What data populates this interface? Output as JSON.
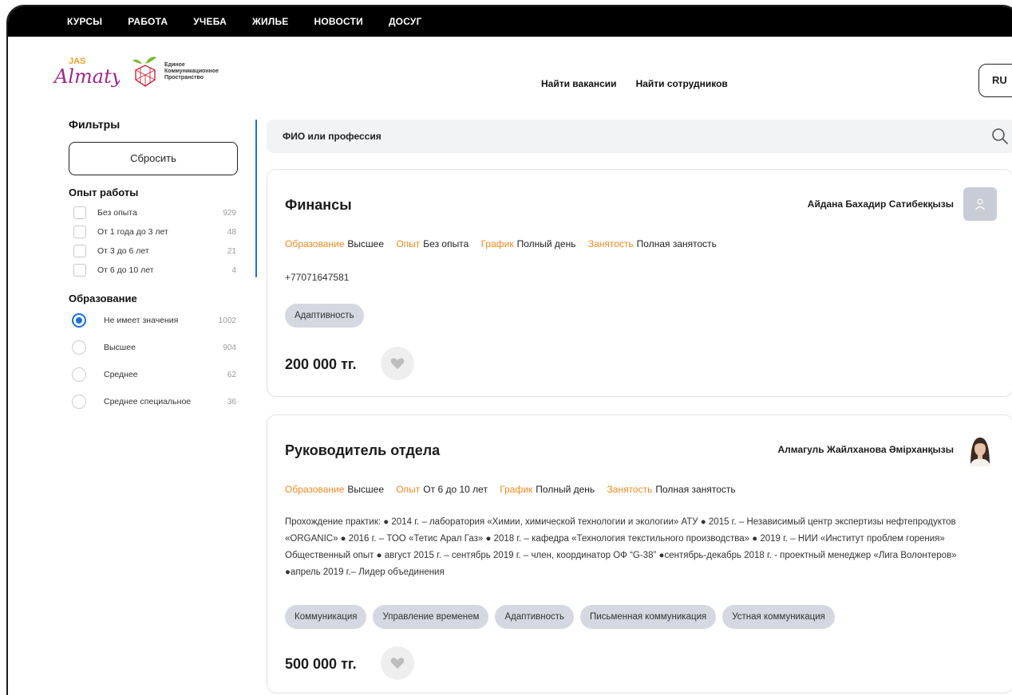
{
  "topnav": [
    "КУРСЫ",
    "РАБОТА",
    "УЧЕБА",
    "ЖИЛЬЕ",
    "НОВОСТИ",
    "ДОСУГ"
  ],
  "header": {
    "logo_jas": "JAS",
    "logo_almaty": "Almaty",
    "logo_ekp": [
      "Единое",
      "Коммуникационное",
      "Пространство"
    ],
    "link_vacancies": "Найти вакансии",
    "link_employees": "Найти сотрудников",
    "lang": "RU"
  },
  "sidebar": {
    "title": "Фильтры",
    "reset": "Сбросить",
    "experience_title": "Опыт работы",
    "experience": [
      {
        "label": "Без опыта",
        "count": "929"
      },
      {
        "label": "От 1 года до 3 лет",
        "count": "48"
      },
      {
        "label": "От 3 до 6 лет",
        "count": "21"
      },
      {
        "label": "От 6 до 10 лет",
        "count": "4"
      }
    ],
    "education_title": "Образование",
    "education": [
      {
        "label": "Не имеет значения",
        "count": "1002",
        "selected": true
      },
      {
        "label": "Высшее",
        "count": "904",
        "selected": false
      },
      {
        "label": "Среднее",
        "count": "62",
        "selected": false
      },
      {
        "label": "Среднее специальное",
        "count": "36",
        "selected": false
      }
    ]
  },
  "search": {
    "placeholder": "ФИО или профессия"
  },
  "cards": [
    {
      "title": "Финансы",
      "name": "Айдана Бахадир Сатибекқызы",
      "meta": [
        {
          "k": "Образование",
          "v": "Высшее"
        },
        {
          "k": "Опыт",
          "v": "Без опыта"
        },
        {
          "k": "График",
          "v": "Полный день"
        },
        {
          "k": "Занятость",
          "v": "Полная занятость"
        }
      ],
      "phone": "+77071647581",
      "tags": [
        "Адаптивность"
      ],
      "price": "200 000 тг."
    },
    {
      "title": "Руководитель отдела",
      "name": "Алмагуль Жайлханова Әмірханқызы",
      "meta": [
        {
          "k": "Образование",
          "v": "Высшее"
        },
        {
          "k": "Опыт",
          "v": "От 6 до 10 лет"
        },
        {
          "k": "График",
          "v": "Полный день"
        },
        {
          "k": "Занятость",
          "v": "Полная занятость"
        }
      ],
      "description": "Прохождение практик: ● 2014 г. – лаборатория «Химии, химической технологии и экологии» АТУ ● 2015 г. – Независимый центр экспертизы нефтепродуктов «ORGANIC» ● 2016 г. – ТОО «Тетис Арал Газ» ● 2018 г. – кафедра «Технология текстильного производства» ● 2019 г. – НИИ «Институт проблем горения» Общественный опыт ● август 2015 г. – сентябрь 2019 г. – член, координатор ОФ “G-38” ●сентябрь-декабрь 2018 г. - проектный менеджер «Лига Волонтеров» ●апрель 2019 г.– Лидер объединения",
      "tags": [
        "Коммуникация",
        "Управление временем",
        "Адаптивность",
        "Письменная коммуникация",
        "Устная коммуникация"
      ],
      "price": "500 000 тг."
    }
  ],
  "colors": {
    "accent": "#f08a24",
    "blue": "#1e6fe0",
    "tag_bg": "#d5d8e0"
  }
}
